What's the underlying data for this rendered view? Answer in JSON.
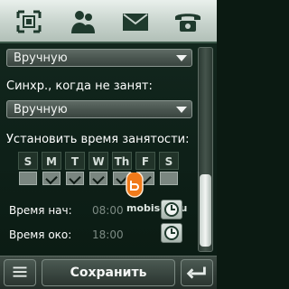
{
  "topbar": {
    "icons": [
      "grid-focus-icon",
      "contacts-icon",
      "envelope-icon",
      "phone-icon"
    ]
  },
  "form": {
    "dropdown1_value": "Вручную",
    "sync_label": "Синхр., когда не занят:",
    "dropdown2_value": "Вручную",
    "busy_time_label": "Установить время занятости:",
    "days": [
      {
        "label": "S",
        "checked": false
      },
      {
        "label": "M",
        "checked": true
      },
      {
        "label": "T",
        "checked": true
      },
      {
        "label": "W",
        "checked": true
      },
      {
        "label": "Th",
        "checked": true
      },
      {
        "label": "F",
        "checked": true
      },
      {
        "label": "S",
        "checked": false
      }
    ],
    "start_label": "Время нач:",
    "start_value": "08:00",
    "end_label": "Время око:",
    "end_value": "18:00"
  },
  "watermark": "mobiset.ru",
  "bottombar": {
    "save_label": "Сохранить"
  },
  "colors": {
    "background": "#0e2018",
    "accent": "#f07a1a"
  }
}
